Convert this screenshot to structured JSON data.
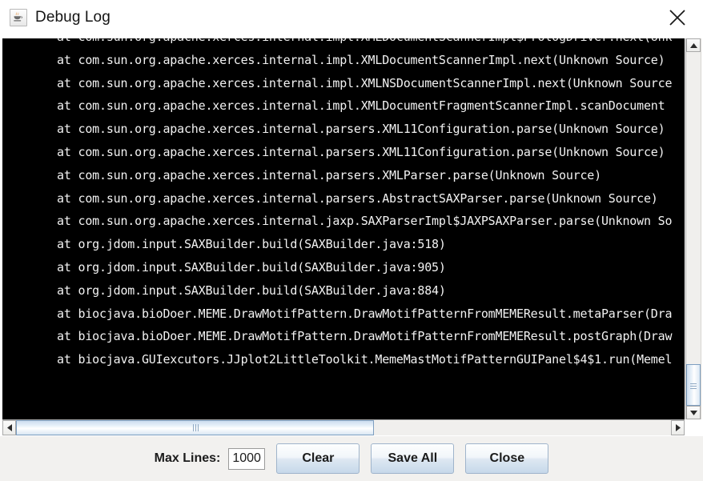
{
  "window": {
    "title": "Debug Log",
    "icon": "java-coffee-cup-icon",
    "close_icon": "close-icon"
  },
  "log": {
    "lines": [
      "at com.sun.org.apache.xerces.internal.impl.XMLDocumentScannerImpl$PrologDriver.next(Unk",
      "at com.sun.org.apache.xerces.internal.impl.XMLDocumentScannerImpl.next(Unknown Source)",
      "at com.sun.org.apache.xerces.internal.impl.XMLNSDocumentScannerImpl.next(Unknown Source",
      "at com.sun.org.apache.xerces.internal.impl.XMLDocumentFragmentScannerImpl.scanDocument",
      "at com.sun.org.apache.xerces.internal.parsers.XML11Configuration.parse(Unknown Source)",
      "at com.sun.org.apache.xerces.internal.parsers.XML11Configuration.parse(Unknown Source)",
      "at com.sun.org.apache.xerces.internal.parsers.XMLParser.parse(Unknown Source)",
      "at com.sun.org.apache.xerces.internal.parsers.AbstractSAXParser.parse(Unknown Source)",
      "at com.sun.org.apache.xerces.internal.jaxp.SAXParserImpl$JAXPSAXParser.parse(Unknown So",
      "at org.jdom.input.SAXBuilder.build(SAXBuilder.java:518)",
      "at org.jdom.input.SAXBuilder.build(SAXBuilder.java:905)",
      "at org.jdom.input.SAXBuilder.build(SAXBuilder.java:884)",
      "at biocjava.bioDoer.MEME.DrawMotifPattern.DrawMotifPatternFromMEMEResult.metaParser(Dra",
      "at biocjava.bioDoer.MEME.DrawMotifPattern.DrawMotifPatternFromMEMEResult.postGraph(Draw",
      "at biocjava.GUIexcutors.JJplot2LittleToolkit.MemeMastMotifPatternGUIPanel$4$1.run(Memel"
    ]
  },
  "scrollbars": {
    "vertical": {
      "up_arrow": "scroll-up-arrow-icon",
      "down_arrow": "scroll-down-arrow-icon"
    },
    "horizontal": {
      "left_arrow": "scroll-left-arrow-icon",
      "right_arrow": "scroll-right-arrow-icon"
    }
  },
  "toolbar": {
    "max_lines_label": "Max Lines:",
    "max_lines_value": "1000",
    "max_lines_placeholder": "1000",
    "clear_label": "Clear",
    "save_all_label": "Save All",
    "close_label": "Close"
  },
  "colors": {
    "log_background": "#000000",
    "log_text": "#f2f2f2",
    "panel_background": "#f2f1ef",
    "button_accent": "#c6d8ea",
    "scrollbar_thumb_border": "#7d9ec0"
  }
}
